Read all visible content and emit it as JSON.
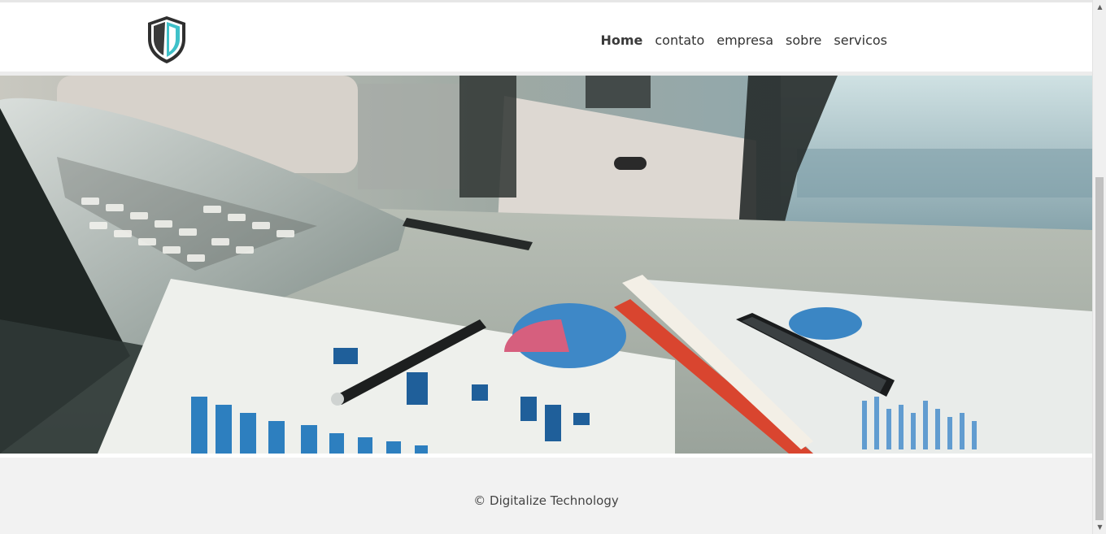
{
  "header": {
    "logo_icon": "shield-icon",
    "colors": {
      "shield_dark": "#3a3a3a",
      "shield_accent": "#3fc1c9"
    }
  },
  "nav": {
    "items": [
      {
        "label": "Home",
        "active": true
      },
      {
        "label": "contato",
        "active": false
      },
      {
        "label": "empresa",
        "active": false
      },
      {
        "label": "sobre",
        "active": false
      },
      {
        "label": "servicos",
        "active": false
      }
    ]
  },
  "hero": {
    "image": "office desk with laptop, pen, smartphone and chart printouts"
  },
  "footer": {
    "copyright": "© Digitalize Technology"
  },
  "scrollbar": {
    "up_icon": "chevron-up-icon",
    "down_icon": "chevron-down-icon"
  }
}
